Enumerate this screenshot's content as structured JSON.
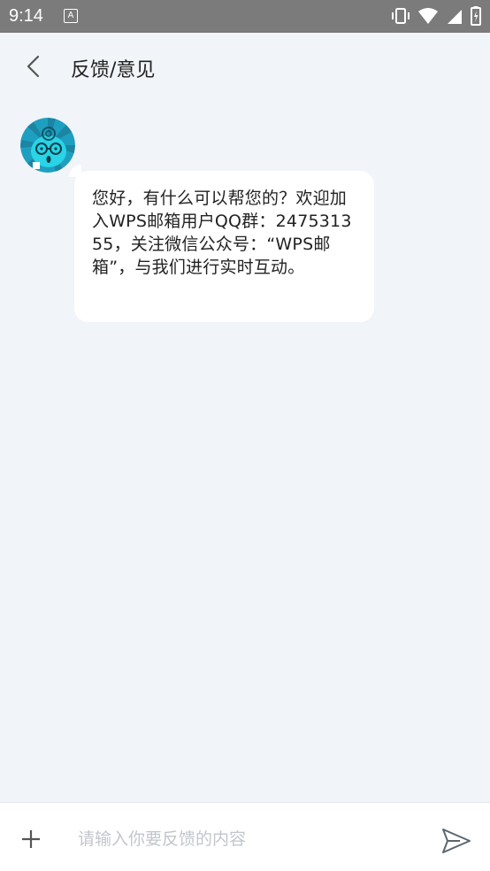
{
  "status_bar": {
    "time": "9:14",
    "notification_icon": "A",
    "icons": [
      "vibrate-icon",
      "wifi-icon",
      "signal-icon",
      "battery-icon"
    ]
  },
  "header": {
    "title": "反馈/意见",
    "back_icon": "back-chevron-icon"
  },
  "chat": {
    "messages": [
      {
        "sender": "assistant",
        "avatar": "assistant-avatar",
        "text": "您好，有什么可以帮您的？欢迎加入WPS邮箱用户QQ群：247531355，关注微信公众号：“WPS邮箱”，与我们进行实时互动。"
      }
    ]
  },
  "composer": {
    "placeholder": "请输入你要反馈的内容",
    "value": "",
    "add_icon": "plus-icon",
    "send_icon": "send-icon"
  },
  "colors": {
    "background": "#f1f4f8",
    "status_bar": "#7b7b7b",
    "bubble": "#ffffff",
    "avatar_bg": "#1fb4d6"
  }
}
